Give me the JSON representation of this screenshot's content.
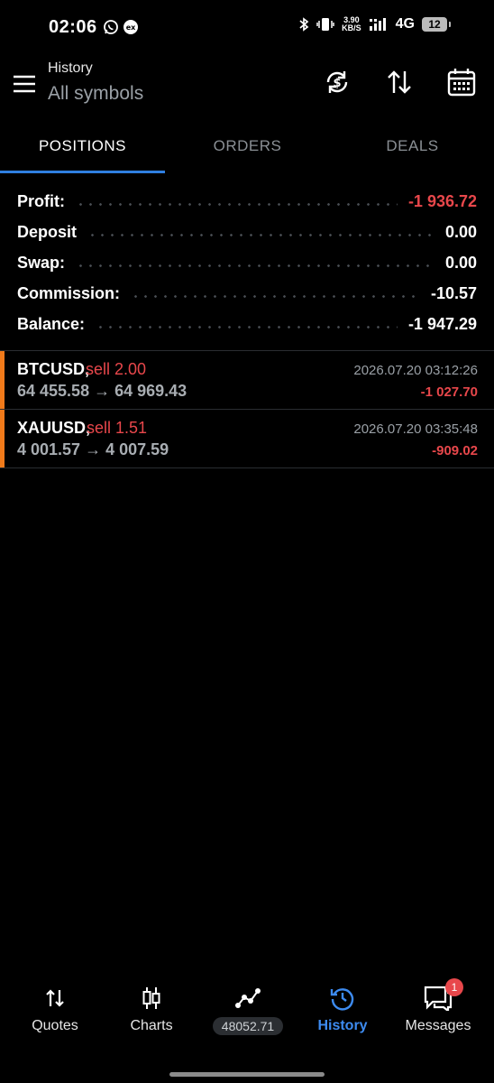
{
  "status_bar": {
    "time": "02:06",
    "net_speed_value": "3.90",
    "net_speed_unit": "KB/S",
    "network_type": "4G",
    "battery_level": "12"
  },
  "header": {
    "title": "History",
    "subtitle": "All symbols"
  },
  "tabs": [
    {
      "label": "POSITIONS",
      "active": true
    },
    {
      "label": "ORDERS",
      "active": false
    },
    {
      "label": "DEALS",
      "active": false
    }
  ],
  "summary": [
    {
      "label": "Profit:",
      "value": "-1 936.72",
      "negative": true
    },
    {
      "label": "Deposit",
      "value": "0.00",
      "negative": false
    },
    {
      "label": "Swap:",
      "value": "0.00",
      "negative": false
    },
    {
      "label": "Commission:",
      "value": "-10.57",
      "negative": false
    },
    {
      "label": "Balance:",
      "value": "-1 947.29",
      "negative": false
    }
  ],
  "positions": [
    {
      "symbol": "BTCUSD,",
      "side": "sell 2.00",
      "prices": "64 455.58 → 64 969.43",
      "time": "2026.07.20 03:12:26",
      "profit": "-1 027.70"
    },
    {
      "symbol": "XAUUSD,",
      "side": "sell 1.51",
      "prices": "4 001.57 → 4 007.59",
      "time": "2026.07.20 03:35:48",
      "profit": "-909.02"
    }
  ],
  "bottom_nav": {
    "quotes": "Quotes",
    "charts": "Charts",
    "trade_value": "48052.71",
    "history": "History",
    "messages": "Messages",
    "messages_badge": "1"
  },
  "colors": {
    "accent": "#2f7fe0",
    "negative": "#e8474b",
    "position_bar": "#f07a1a"
  }
}
